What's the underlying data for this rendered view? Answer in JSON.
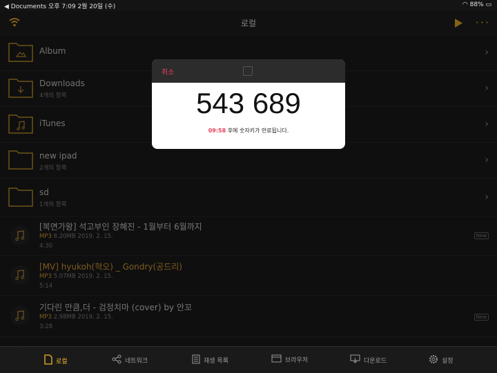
{
  "status": {
    "left": "◀ Documents  오후 7:09  2월 20일 (수)",
    "right": "88%"
  },
  "nav": {
    "title": "로컬",
    "more": "···"
  },
  "folders": [
    {
      "name": "Album",
      "sub": ""
    },
    {
      "name": "Downloads",
      "sub": "4개의 항목"
    },
    {
      "name": "iTunes",
      "sub": ""
    },
    {
      "name": "new ipad",
      "sub": "2개의 항목"
    },
    {
      "name": "sd",
      "sub": "1개의 항목"
    }
  ],
  "tracks": [
    {
      "name": "[복면가왕] 석고부인 장혜진 - 1월부터 6월까지",
      "fmt": "MP3",
      "meta": "6.20MB 2019. 2. 15.",
      "dur": "4:30",
      "badge": "New",
      "orange": false
    },
    {
      "name": "[MV] hyukoh(혁오) _ Gondry(공드리)",
      "fmt": "MP3",
      "meta": "5.07MB 2019. 2. 15.",
      "dur": "5:14",
      "badge": "",
      "orange": true
    },
    {
      "name": "기다린 만큼,더 - 검정치마 (cover) by 안꼬",
      "fmt": "MP3",
      "meta": "2.98MB 2019. 2. 15.",
      "dur": "3:28",
      "badge": "New",
      "orange": false
    }
  ],
  "modal": {
    "cancel": "취소",
    "code": "543 689",
    "expire_time": "09:58",
    "expire_text": " 후에 숫자키가 만료됩니다."
  },
  "tabs": [
    {
      "label": "로컬",
      "icon": "document-icon"
    },
    {
      "label": "네트워크",
      "icon": "share-icon"
    },
    {
      "label": "재생 목록",
      "icon": "list-icon"
    },
    {
      "label": "브라우저",
      "icon": "browser-icon"
    },
    {
      "label": "다운로드",
      "icon": "download-icon"
    },
    {
      "label": "설정",
      "icon": "gear-icon"
    }
  ]
}
